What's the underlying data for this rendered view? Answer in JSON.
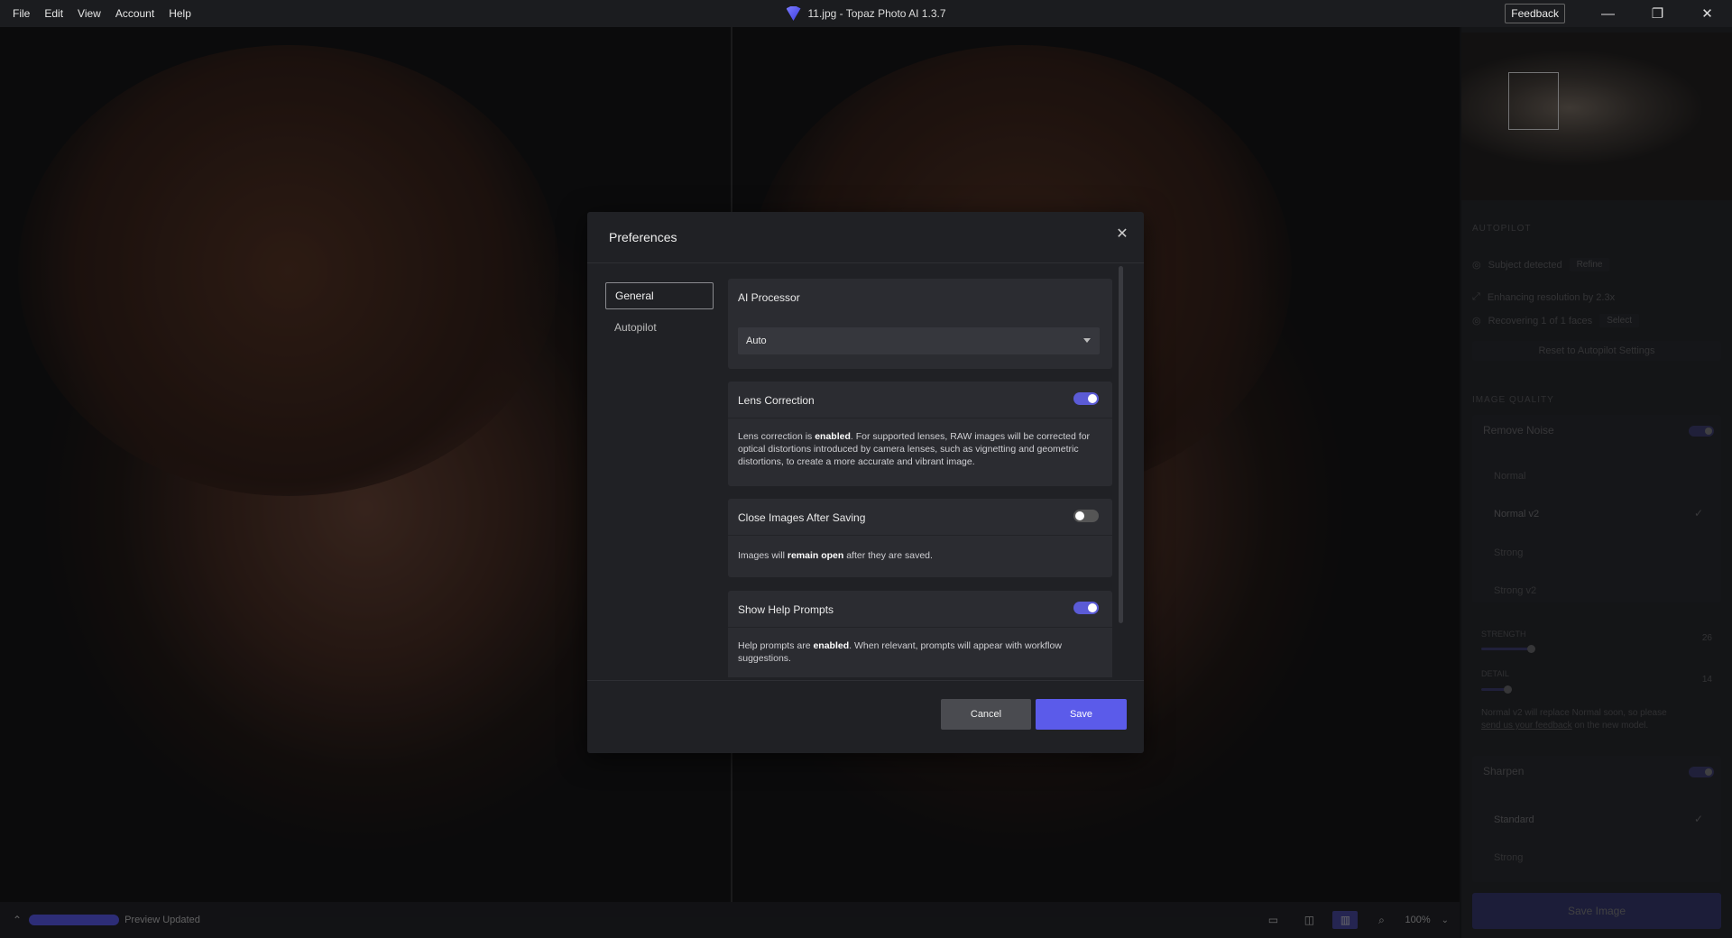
{
  "titlebar": {
    "menu": [
      "File",
      "Edit",
      "View",
      "Account",
      "Help"
    ],
    "title": "11.jpg - Topaz Photo AI 1.3.7",
    "feedback": "Feedback",
    "minimize_icon": "minimize-icon",
    "restore_icon": "restore-icon",
    "close_icon": "close-icon"
  },
  "sidebar": {
    "autopilot_label": "AUTOPILOT",
    "subject_detected": "Subject detected",
    "refine": "Refine",
    "enhancing": "Enhancing resolution by 2.3x",
    "recovering": "Recovering 1 of 1 faces",
    "select": "Select",
    "reset": "Reset to Autopilot Settings",
    "image_quality": "IMAGE QUALITY",
    "remove_noise": "Remove Noise",
    "noise_options": [
      "Normal",
      "Normal v2",
      "Strong",
      "Strong v2"
    ],
    "noise_selected": "Normal v2",
    "strength_label": "STRENGTH",
    "strength_value": "26",
    "detail_label": "DETAIL",
    "detail_value": "14",
    "note_line1": "Normal v2 will replace Normal soon, so please",
    "note_link": "send us your feedback",
    "note_line2_tail": "on the new model.",
    "sharpen": "Sharpen",
    "sharpen_options": [
      "Standard",
      "Strong"
    ],
    "save_image": "Save Image"
  },
  "bottombar": {
    "status": "Preview Updated",
    "zoom": "100%"
  },
  "modal": {
    "title": "Preferences",
    "nav": [
      "General",
      "Autopilot"
    ],
    "ai_processor": {
      "title": "AI Processor",
      "value": "Auto"
    },
    "lens_correction": {
      "title": "Lens Correction",
      "enabled": true,
      "desc_pre": "Lens correction is ",
      "desc_bold": "enabled",
      "desc_post": ". For supported lenses, RAW images will be corrected for optical distortions introduced by camera lenses, such as vignetting and geometric distortions, to create a more accurate and vibrant image."
    },
    "close_after_saving": {
      "title": "Close Images After Saving",
      "enabled": false,
      "desc_pre": "Images will ",
      "desc_bold": "remain open",
      "desc_post": " after they are saved."
    },
    "help_prompts": {
      "title": "Show Help Prompts",
      "enabled": true,
      "desc_pre": "Help prompts are ",
      "desc_bold": "enabled",
      "desc_post": ". When relevant, prompts will appear with workflow suggestions."
    },
    "cancel": "Cancel",
    "save": "Save"
  }
}
